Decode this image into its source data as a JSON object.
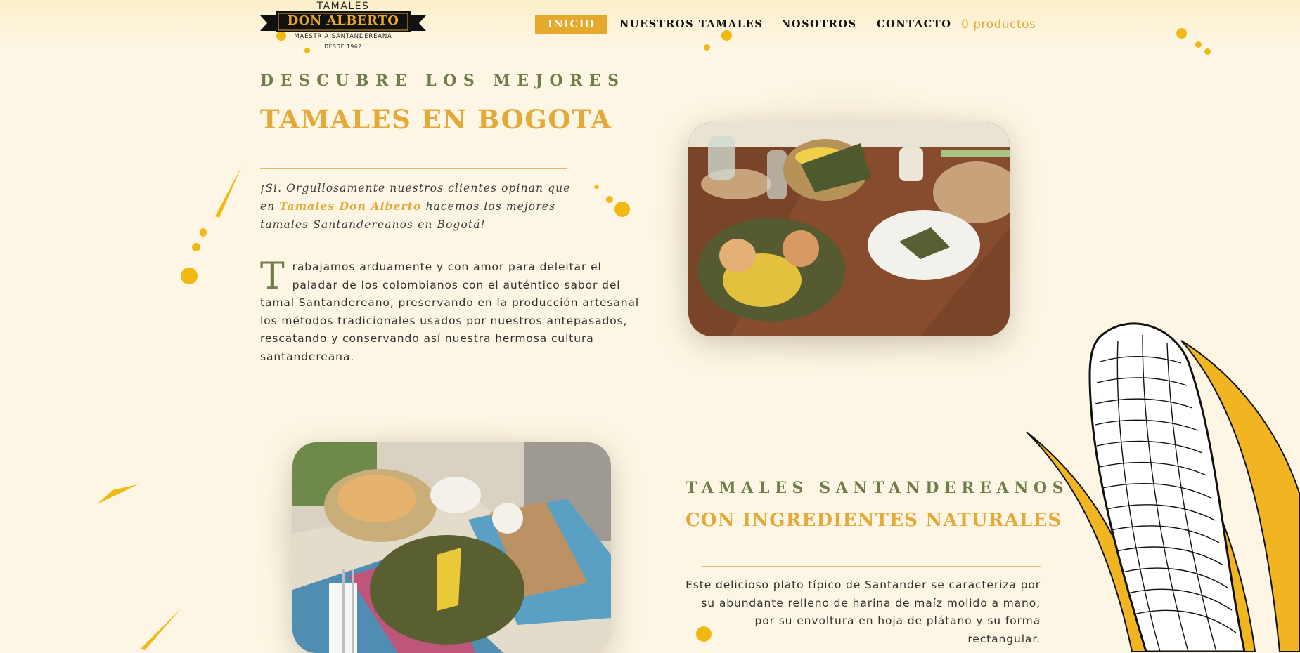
{
  "brand": {
    "top": "TAMALES",
    "name": "DON ALBERTO",
    "tagline": "MAESTRÍA SANTANDEREANA",
    "since": "DESDE 1962"
  },
  "nav": {
    "items": [
      {
        "label": "INICIO",
        "active": true
      },
      {
        "label": "NUESTROS TAMALES",
        "active": false
      },
      {
        "label": "NOSOTROS",
        "active": false
      },
      {
        "label": "CONTACTO",
        "active": false
      }
    ],
    "cart": "0 productos"
  },
  "hero": {
    "kicker": "DESCUBRE LOS MEJORES",
    "title": "TAMALES EN BOGOTA",
    "quote_before": "¡Si. Orgullosamente nuestros clientes opinan que en ",
    "quote_brand": "Tamales Don Alberto",
    "quote_after": " hacemos los mejores tamales Santandereanos en Bogotá!",
    "dropcap": "T",
    "body": "rabajamos arduamente y con amor para deleitar el paladar de los colombianos con el auténtico sabor del tamal Santandereano, preservando en la producción artesanal los métodos tradicionales usados por nuestros antepasados, rescatando y conservando así nuestra hermosa cultura santandereana."
  },
  "section2": {
    "kicker": "TAMALES SANTANDEREANOS",
    "title": "CON INGREDIENTES NATURALES",
    "body": "Este delicioso plato típico de Santander se caracteriza por su abundante relleno de harina de maíz molido a mano, por su envoltura en hoja de plátano y su forma rectangular."
  },
  "colors": {
    "background": "#fdf6e4",
    "accent_gold": "#e5a93a",
    "olive": "#6f7d4b",
    "splash_yellow": "#f1b914"
  },
  "icons": [
    "corn-illustration",
    "paint-splash-decoration"
  ]
}
